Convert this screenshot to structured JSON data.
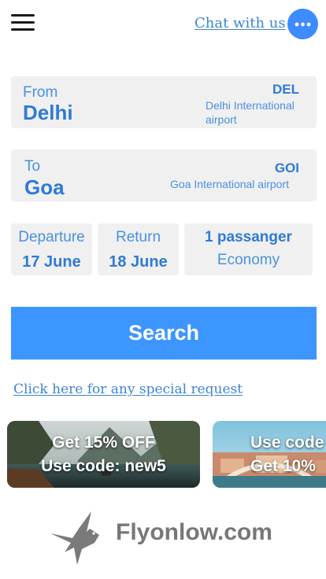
{
  "header": {
    "menu_icon": "hamburger-menu-icon",
    "chat_label": "Chat with us",
    "chat_icon": "chat-bubble-icon",
    "accent_color": "#3d8bff"
  },
  "from": {
    "label": "From",
    "city": "Delhi",
    "code": "DEL",
    "airport": "Delhi International airport"
  },
  "to": {
    "label": "To",
    "city": "Goa",
    "code": "GOI",
    "airport": "Goa International airport"
  },
  "departure": {
    "label": "Departure",
    "value": "17 June"
  },
  "return": {
    "label": "Return",
    "value": "18 June"
  },
  "passengers": {
    "count_label": "1 passanger",
    "class": "Economy"
  },
  "search": {
    "label": "Search",
    "color": "#3d96ff"
  },
  "special_request": {
    "label": "Click here for any special request"
  },
  "promos": [
    {
      "line1": "Get 15% OFF",
      "line2": "Use code: new5"
    },
    {
      "line1": "Use code",
      "line2": "Get 10%"
    }
  ],
  "brand": {
    "name": "Flyonlow.com",
    "logo_icon": "bird-logo-icon"
  }
}
